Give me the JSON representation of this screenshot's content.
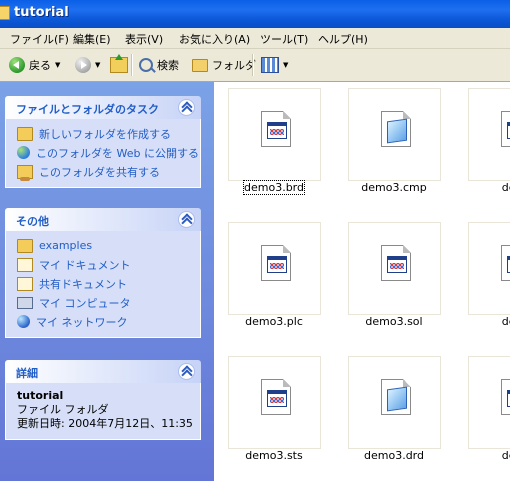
{
  "window": {
    "title": "tutorial"
  },
  "menu": [
    "ファイル(F)",
    "編集(E)",
    "表示(V)",
    "お気に入り(A)",
    "ツール(T)",
    "ヘルプ(H)"
  ],
  "toolbar": {
    "back_label": "戻る",
    "search_label": "検索",
    "folders_label": "フォルダ"
  },
  "tasks_panel": {
    "title": "ファイルとフォルダのタスク",
    "items": [
      "新しいフォルダを作成する",
      "このフォルダを Web に公開する",
      "このフォルダを共有する"
    ]
  },
  "other_panel": {
    "title": "その他",
    "items": [
      "examples",
      "マイ ドキュメント",
      "共有ドキュメント",
      "マイ コンピュータ",
      "マイ ネットワーク"
    ]
  },
  "details_panel": {
    "title": "詳細",
    "name": "tutorial",
    "type": "ファイル フォルダ",
    "modified": "更新日時: 2004年7月12日、11:35"
  },
  "files": [
    {
      "name": "demo3.brd",
      "icon": "app-icon"
    },
    {
      "name": "demo3.cmp",
      "icon": "cmp-icon"
    },
    {
      "name": "dem",
      "icon": "app-icon"
    },
    {
      "name": "demo3.plc",
      "icon": "app-icon"
    },
    {
      "name": "demo3.sol",
      "icon": "app-icon"
    },
    {
      "name": "dem",
      "icon": "app-icon"
    },
    {
      "name": "demo3.sts",
      "icon": "app-icon"
    },
    {
      "name": "demo3.drd",
      "icon": "cmp-icon"
    },
    {
      "name": "dem",
      "icon": "app-icon"
    }
  ],
  "selected_file": "demo3.brd"
}
